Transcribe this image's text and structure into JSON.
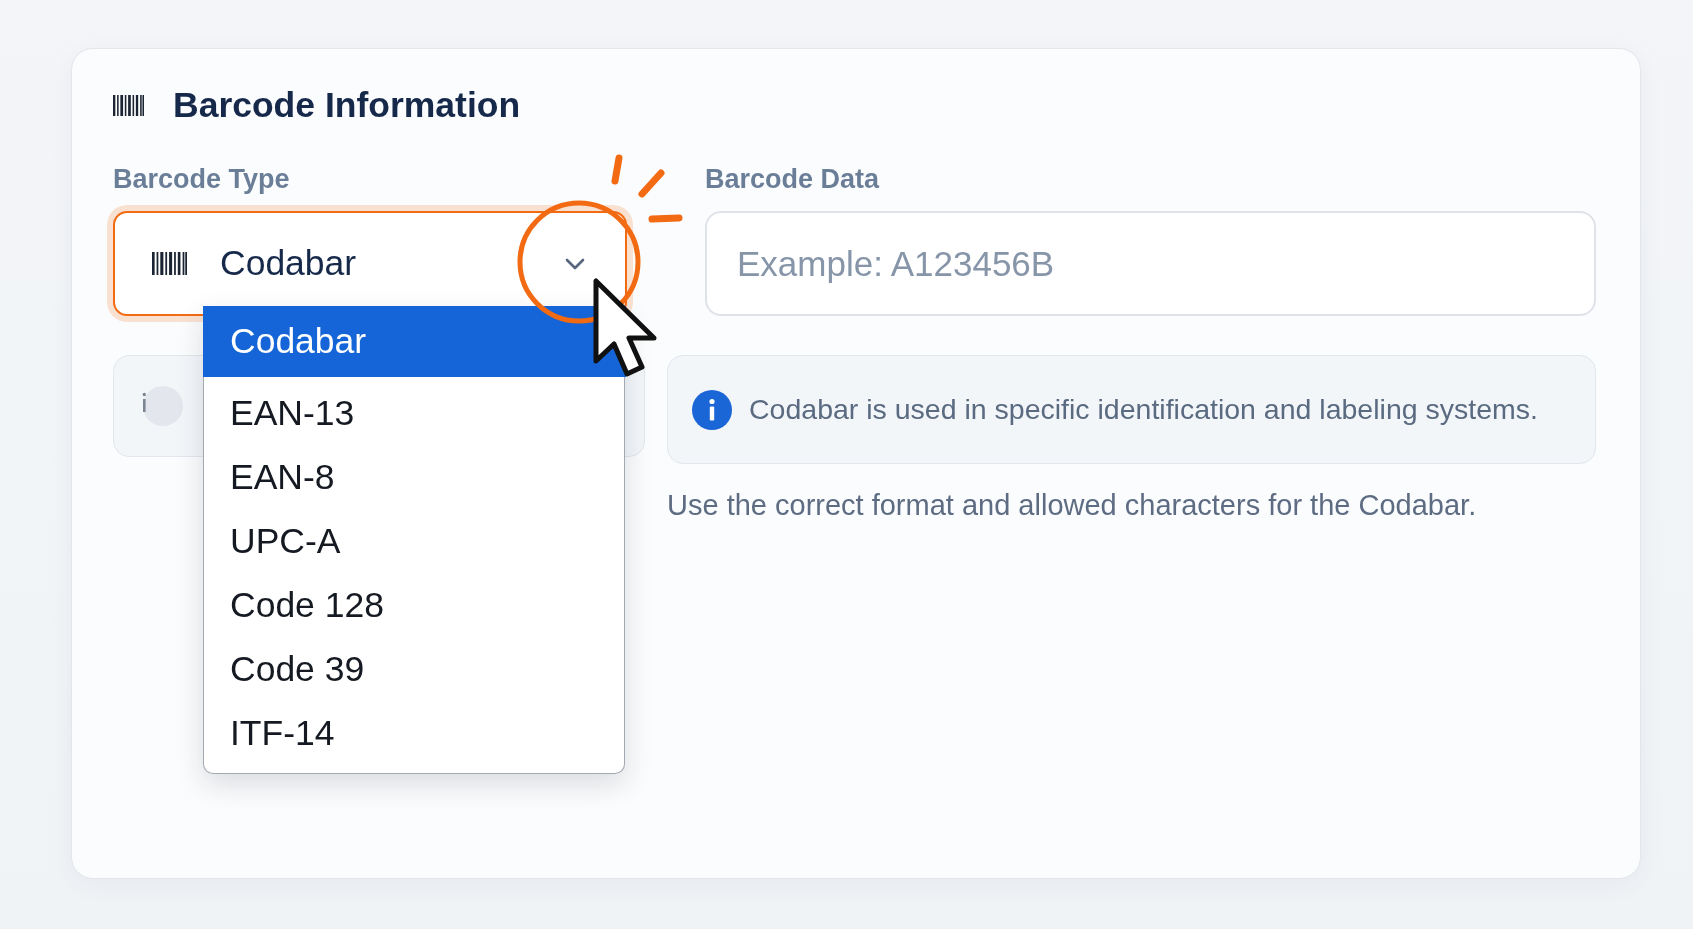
{
  "card": {
    "title": "Barcode Information"
  },
  "barcode_type": {
    "label": "Barcode Type",
    "value": "Codabar",
    "focused": true,
    "expanded": true,
    "options": [
      {
        "label": "Codabar",
        "selected": true
      },
      {
        "label": "EAN-13",
        "selected": false
      },
      {
        "label": "EAN-8",
        "selected": false
      },
      {
        "label": "UPC-A",
        "selected": false
      },
      {
        "label": "Code 128",
        "selected": false
      },
      {
        "label": "Code 39",
        "selected": false
      },
      {
        "label": "ITF-14",
        "selected": false
      }
    ]
  },
  "barcode_data": {
    "label": "Barcode Data",
    "placeholder": "Example: A123456B"
  },
  "info": {
    "text": "Codabar is used in specific identification and labeling systems."
  },
  "hint": "Use the correct format and allowed characters for the Codabar."
}
